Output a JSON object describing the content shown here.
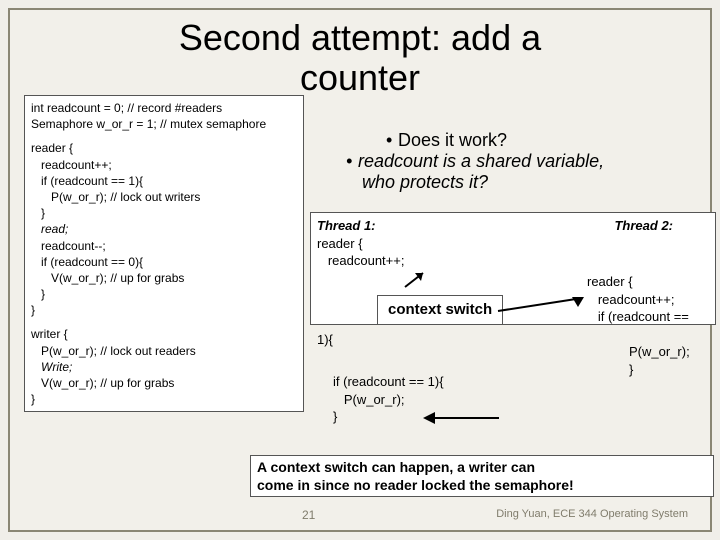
{
  "title_line1": "Second attempt: add a",
  "title_line2": "counter",
  "leftbox": {
    "l1": "int readcount = 0; // record #readers",
    "l2": "Semaphore w_or_r = 1; // mutex semaphore",
    "reader_head": "reader {",
    "rl1": "   readcount++;",
    "rl2": "   if (readcount == 1){",
    "rl3": "      P(w_or_r); // lock out writers",
    "rl4": "   }",
    "rl5a": "   read;",
    "rl5": "   readcount--;",
    "rl6": "   if (readcount == 0){",
    "rl7": "      V(w_or_r); // up for grabs",
    "rl8": "   }",
    "rclose": "}",
    "writer_head": "writer {",
    "wl1": "   P(w_or_r); // lock out readers",
    "wl2a": "   Write;",
    "wl2": "   V(w_or_r); // up for grabs",
    "wclose": "}"
  },
  "notes": {
    "q1": "Does it work?",
    "q2a": "readcount is a shared variable,",
    "q2b": "who protects it?"
  },
  "threadbox": {
    "t1label": "Thread 1:",
    "t2label": "Thread 2:",
    "t1a": "reader {",
    "t1b": "   readcount++;",
    "ctx": "context switch",
    "oneopen": "1){",
    "t2a": "reader {",
    "t2b": "   readcount++;",
    "t2c": "   if (readcount ==",
    "t2d": "P(w_or_r);",
    "t2e": "}",
    "t1c": "if (readcount == 1){",
    "t1d": "   P(w_or_r);",
    "t1e": "}"
  },
  "moral": {
    "m1": "A context switch can happen, a writer can",
    "m2": "come in since no reader locked the semaphore!"
  },
  "pagenum": "21",
  "footer": "Ding Yuan, ECE 344 Operating System"
}
